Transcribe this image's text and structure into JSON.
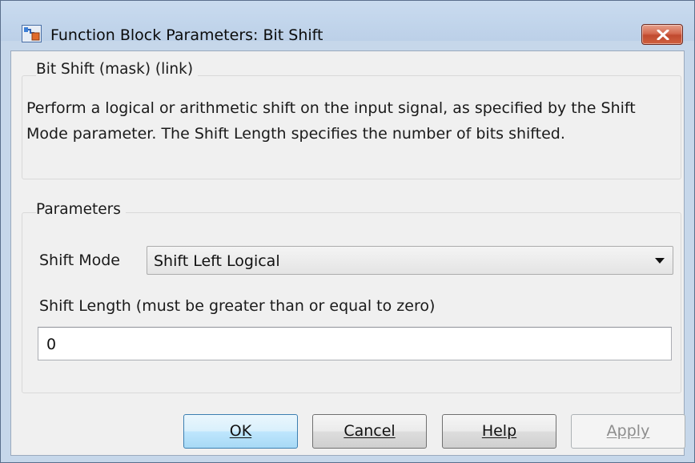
{
  "window": {
    "title": "Function Block Parameters: Bit Shift",
    "close_symbol": "close-icon"
  },
  "block": {
    "header": "Bit Shift (mask) (link)",
    "description": "Perform a logical or arithmetic shift on the input signal, as specified by the Shift Mode parameter. The Shift Length specifies the number of bits shifted."
  },
  "parameters": {
    "header": "Parameters",
    "shift_mode_label": "Shift Mode",
    "shift_mode_value": "Shift Left Logical",
    "shift_length_label": "Shift Length (must be greater than or equal to zero)",
    "shift_length_value": "0"
  },
  "buttons": {
    "ok": "OK",
    "cancel": "Cancel",
    "help": "Help",
    "apply": "Apply"
  },
  "colors": {
    "accent_default_button": "#3c7fb1",
    "close_button": "#c04a2f",
    "frame": "#c6d7ea"
  }
}
